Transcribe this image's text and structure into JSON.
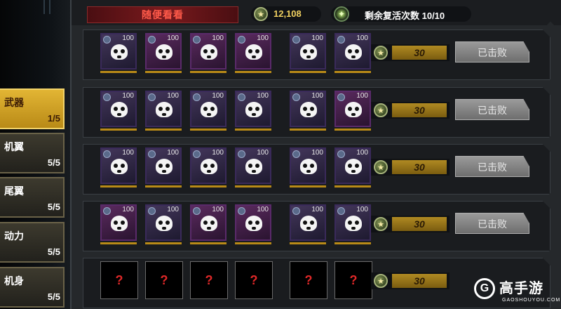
{
  "top": {
    "random_label": "随便看看",
    "currency_value": "12,108",
    "revive_text": "剩余复活次数 10/10"
  },
  "tabs": [
    {
      "name": "武器",
      "count": "1/5",
      "active": true
    },
    {
      "name": "机翼",
      "count": "5/5",
      "active": false
    },
    {
      "name": "尾翼",
      "count": "5/5",
      "active": false
    },
    {
      "name": "动力",
      "count": "5/5",
      "active": false
    },
    {
      "name": "机身",
      "count": "5/5",
      "active": false
    }
  ],
  "rows": [
    {
      "level": "100",
      "cost": "30",
      "button": "已击败",
      "unknown": false
    },
    {
      "level": "100",
      "cost": "30",
      "button": "已击败",
      "unknown": false
    },
    {
      "level": "100",
      "cost": "30",
      "button": "已击败",
      "unknown": false
    },
    {
      "level": "100",
      "cost": "30",
      "button": "已击败",
      "unknown": false
    },
    {
      "level": "",
      "cost": "30",
      "button": "",
      "unknown": true,
      "unknown_mark": "?"
    }
  ],
  "logo": {
    "name": "高手游",
    "url": "GAOSHOUYOU.COM",
    "mark": "G"
  },
  "colors": {
    "accent_gold": "#e2b534",
    "danger_red": "#ff5a4a"
  }
}
